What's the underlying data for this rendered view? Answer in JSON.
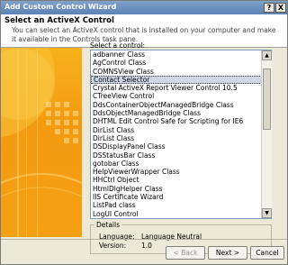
{
  "window": {
    "title": "Add Custom Control Wizard"
  },
  "titlebar_buttons": {
    "help": "?",
    "close": "X"
  },
  "header": {
    "title": "Select an ActiveX Control",
    "description": "You can select an ActiveX control that is installed on your computer and make it available in the Controls task pane."
  },
  "list": {
    "label": "Select a control:",
    "items": [
      "adbanner Class",
      "AgControl Class",
      "COMNSView Class",
      "Contact Selector",
      "Crystal ActiveX Report Viewer Control 10.5",
      "CTreeView Control",
      "DdsContainerObjectManagedBridge Class",
      "DdsObjectManagedBridge Class",
      "DHTML Edit Control Safe for Scripting for IE6",
      "DirList Class",
      "DirList Class",
      "DSDisplayPanel Class",
      "DSStatusBar Class",
      "gotobar Class",
      "HelpViewerWrapper Class",
      "HHCtrl Object",
      "HtmlDlgHelper Class",
      "IIS Certificate Wizard",
      "ListPad class",
      "LogUI Control"
    ],
    "selected_index": 3
  },
  "details": {
    "legend": "Details",
    "language_label": "Language:",
    "language_value": "Language Neutral",
    "version_label": "Version:",
    "version_value": "1.0"
  },
  "buttons": {
    "back": "< Back",
    "next": "Next >",
    "cancel": "Cancel"
  }
}
